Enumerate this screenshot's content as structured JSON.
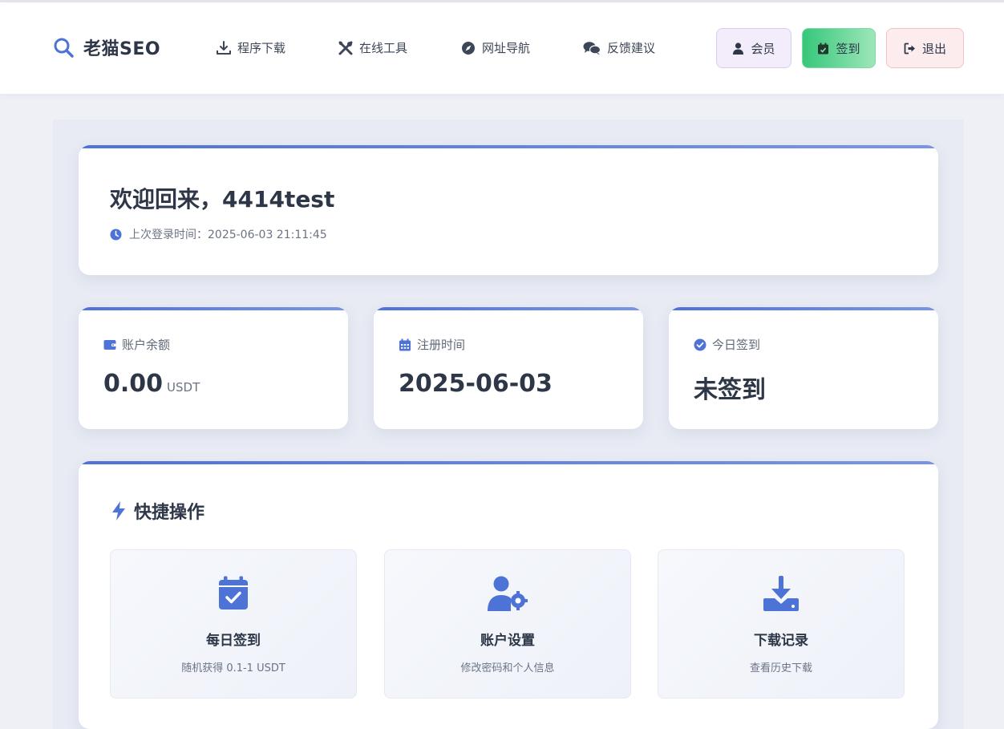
{
  "header": {
    "logo_text": "老猫SEO",
    "nav": [
      {
        "label": "程序下载",
        "icon": "download-icon"
      },
      {
        "label": "在线工具",
        "icon": "tools-icon"
      },
      {
        "label": "网址导航",
        "icon": "compass-icon"
      },
      {
        "label": "反馈建议",
        "icon": "comments-icon"
      }
    ],
    "buttons": {
      "member": "会员",
      "sign": "签到",
      "logout": "退出"
    }
  },
  "welcome": {
    "title": "欢迎回来，4414test",
    "last_login": "上次登录时间：2025-06-03 21:11:45"
  },
  "stats": [
    {
      "label": "账户余额",
      "value": "0.00",
      "unit": "USDT",
      "icon": "wallet-icon"
    },
    {
      "label": "注册时间",
      "value": "2025-06-03",
      "icon": "calendar-icon"
    },
    {
      "label": "今日签到",
      "value": "未签到",
      "icon": "check-circle-icon"
    }
  ],
  "quick": {
    "title": "快捷操作",
    "actions": [
      {
        "title": "每日签到",
        "desc": "随机获得 0.1-1 USDT",
        "icon": "calendar-check-icon"
      },
      {
        "title": "账户设置",
        "desc": "修改密码和个人信息",
        "icon": "user-gear-icon"
      },
      {
        "title": "下载记录",
        "desc": "查看历史下载",
        "icon": "download-icon"
      }
    ]
  },
  "colors": {
    "accent": "#4e73d6",
    "sign_green": "#36c77a",
    "logout_pink": "#fdecee",
    "member_purple": "#f2ecfb"
  }
}
